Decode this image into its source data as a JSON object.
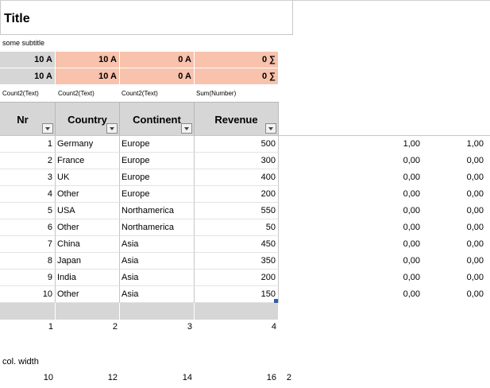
{
  "title": "Title",
  "subtitle": "some subtitle",
  "count_rows": [
    [
      "10 A",
      "10 A",
      "0 A",
      "0 ∑"
    ],
    [
      "10 A",
      "10 A",
      "0 A",
      "0 ∑"
    ]
  ],
  "aggregates": [
    "Count2(Text)",
    "Count2(Text)",
    "Count2(Text)",
    "Sum(Number)"
  ],
  "headers": [
    "Nr",
    "Country",
    "Continent",
    "Revenue"
  ],
  "rows": [
    {
      "nr": "1",
      "country": "Germany",
      "continent": "Europe",
      "revenue": "500",
      "extra1": "1,00",
      "extra2": "1,00"
    },
    {
      "nr": "2",
      "country": "France",
      "continent": "Europe",
      "revenue": "300",
      "extra1": "0,00",
      "extra2": "0,00"
    },
    {
      "nr": "3",
      "country": "UK",
      "continent": "Europe",
      "revenue": "400",
      "extra1": "0,00",
      "extra2": "0,00"
    },
    {
      "nr": "4",
      "country": "Other",
      "continent": "Europe",
      "revenue": "200",
      "extra1": "0,00",
      "extra2": "0,00"
    },
    {
      "nr": "5",
      "country": "USA",
      "continent": "Northamerica",
      "revenue": "550",
      "extra1": "0,00",
      "extra2": "0,00"
    },
    {
      "nr": "6",
      "country": "Other",
      "continent": "Northamerica",
      "revenue": "50",
      "extra1": "0,00",
      "extra2": "0,00"
    },
    {
      "nr": "7",
      "country": "China",
      "continent": "Asia",
      "revenue": "450",
      "extra1": "0,00",
      "extra2": "0,00"
    },
    {
      "nr": "8",
      "country": "Japan",
      "continent": "Asia",
      "revenue": "350",
      "extra1": "0,00",
      "extra2": "0,00"
    },
    {
      "nr": "9",
      "country": "India",
      "continent": "Asia",
      "revenue": "200",
      "extra1": "0,00",
      "extra2": "0,00"
    },
    {
      "nr": "10",
      "country": "Other",
      "continent": "Asia",
      "revenue": "150",
      "extra1": "0,00",
      "extra2": "0,00"
    }
  ],
  "column_numbers": [
    "1",
    "2",
    "3",
    "4"
  ],
  "col_width_label": "col. width",
  "col_widths": [
    "10",
    "12",
    "14",
    "16",
    "2"
  ],
  "colors": {
    "header_grey": "#d6d6d6",
    "salmon": "#f8c2ad",
    "handle_blue": "#2f5ea8"
  }
}
